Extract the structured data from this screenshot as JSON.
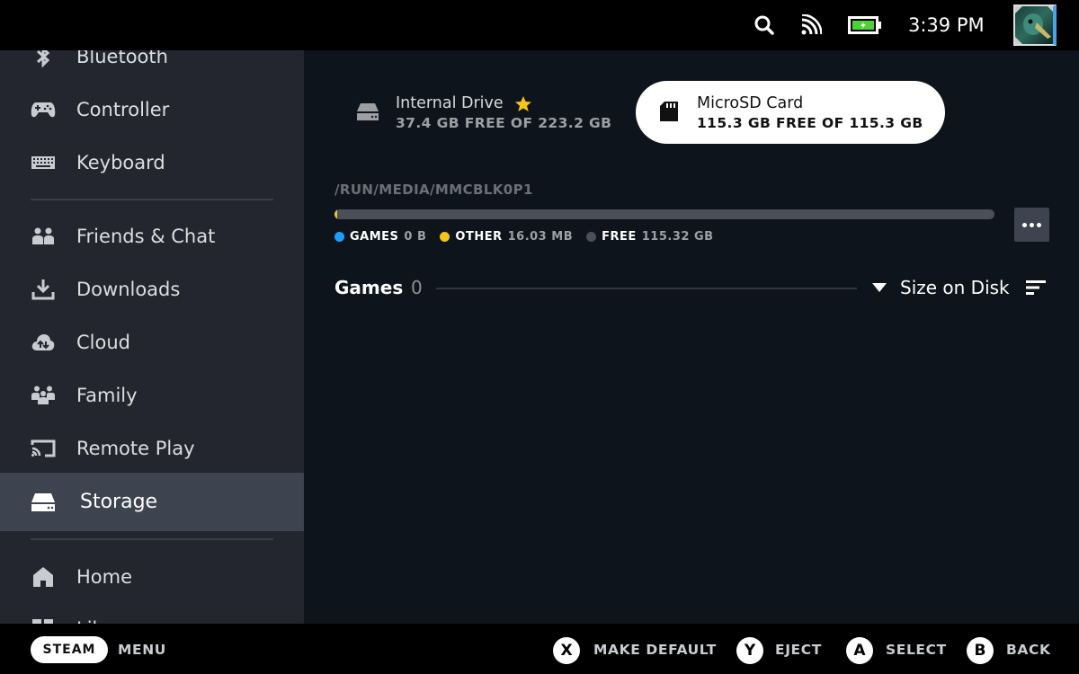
{
  "status_bar": {
    "icons": [
      "search-icon",
      "wifi-icon",
      "battery-charging-icon"
    ],
    "time": "3:39 PM",
    "battery_color": "#4cd137"
  },
  "sidebar": {
    "items": [
      {
        "label": "Bluetooth",
        "icon": "bluetooth-icon"
      },
      {
        "label": "Controller",
        "icon": "controller-icon"
      },
      {
        "label": "Keyboard",
        "icon": "keyboard-icon"
      },
      {
        "label": "Friends & Chat",
        "icon": "friends-icon"
      },
      {
        "label": "Downloads",
        "icon": "download-icon"
      },
      {
        "label": "Cloud",
        "icon": "cloud-icon"
      },
      {
        "label": "Family",
        "icon": "family-icon"
      },
      {
        "label": "Remote Play",
        "icon": "remote-play-icon"
      },
      {
        "label": "Storage",
        "icon": "storage-icon",
        "active": true
      },
      {
        "label": "Home",
        "icon": "home-icon"
      },
      {
        "label": "Library",
        "icon": "library-icon"
      }
    ]
  },
  "drives": [
    {
      "name": "Internal Drive",
      "starred": true,
      "free_text": "37.4 GB FREE OF 223.2 GB",
      "icon": "hard-drive-icon",
      "selected": false
    },
    {
      "name": "MicroSD Card",
      "starred": false,
      "free_text": "115.3 GB FREE OF 115.3 GB",
      "icon": "sd-card-icon",
      "selected": true
    }
  ],
  "storage": {
    "path": "/RUN/MEDIA/MMCBLK0P1",
    "usage_fraction": {
      "games": 0.0,
      "other": 0.00014,
      "free": 0.99986
    },
    "legend": [
      {
        "key": "GAMES",
        "value": "0 B",
        "color": "#1a9fff"
      },
      {
        "key": "OTHER",
        "value": "16.03 MB",
        "color": "#f5c518"
      },
      {
        "key": "FREE",
        "value": "115.32 GB",
        "color": "#4a4f58"
      }
    ],
    "more_button": "more-options"
  },
  "games_section": {
    "title": "Games",
    "count": "0",
    "sort_label": "Size on Disk"
  },
  "bottom_bar": {
    "steam_label": "STEAM",
    "menu_label": "MENU",
    "hints": [
      {
        "button": "X",
        "label": "MAKE DEFAULT"
      },
      {
        "button": "Y",
        "label": "EJECT"
      },
      {
        "button": "A",
        "label": "SELECT"
      },
      {
        "button": "B",
        "label": "BACK"
      }
    ]
  }
}
